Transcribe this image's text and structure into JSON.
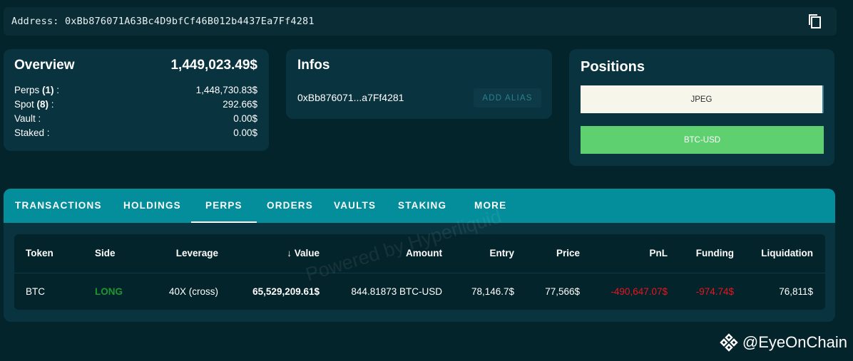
{
  "address_bar": {
    "label": "Address:",
    "value": "0xBb876071A63Bc4D9bfCf46B012b4437Ea7Ff4281"
  },
  "overview": {
    "title": "Overview",
    "total": "1,449,023.49$",
    "rows": [
      {
        "label": "Perps",
        "count": "(1)",
        "suffix": " :",
        "value": "1,448,730.83$"
      },
      {
        "label": "Spot",
        "count": "(8)",
        "suffix": " :",
        "value": "292.66$"
      },
      {
        "label": "Vault :",
        "count": "",
        "suffix": "",
        "value": "0.00$"
      },
      {
        "label": "Staked :",
        "count": "",
        "suffix": "",
        "value": "0.00$"
      }
    ]
  },
  "infos": {
    "title": "Infos",
    "address_short": "0xBb876071...a7Ff4281",
    "alias_button": "ADD ALIAS"
  },
  "positions": {
    "title": "Positions",
    "items": [
      "JPEG",
      "BTC-USD"
    ]
  },
  "tabs": [
    {
      "label": "TRANSACTIONS"
    },
    {
      "label": "HOLDINGS"
    },
    {
      "label": "PERPS",
      "active": true
    },
    {
      "label": "ORDERS"
    },
    {
      "label": "VAULTS"
    },
    {
      "label": "STAKING"
    },
    {
      "label": "MORE"
    }
  ],
  "table": {
    "headers": [
      "Token",
      "Side",
      "Leverage",
      "Value",
      "Amount",
      "Entry",
      "Price",
      "PnL",
      "Funding",
      "Liquidation"
    ],
    "sort_indicator": "↓",
    "rows": [
      [
        "BTC",
        "LONG",
        "40X (cross)",
        "65,529,209.61$",
        "844.81873 BTC-USD",
        "78,146.7$",
        "77,566$",
        "-490,647.07$",
        "-974.74$",
        "76,811$"
      ]
    ]
  },
  "watermark": "Powered by Hyperliquid",
  "credit": "@EyeOnChain",
  "colors": {
    "background": "#04242b",
    "card": "#0a3340",
    "tabbar": "#048d9a",
    "long": "#1f9632",
    "negative": "#e8141e",
    "btc_button": "#5fd06f"
  }
}
